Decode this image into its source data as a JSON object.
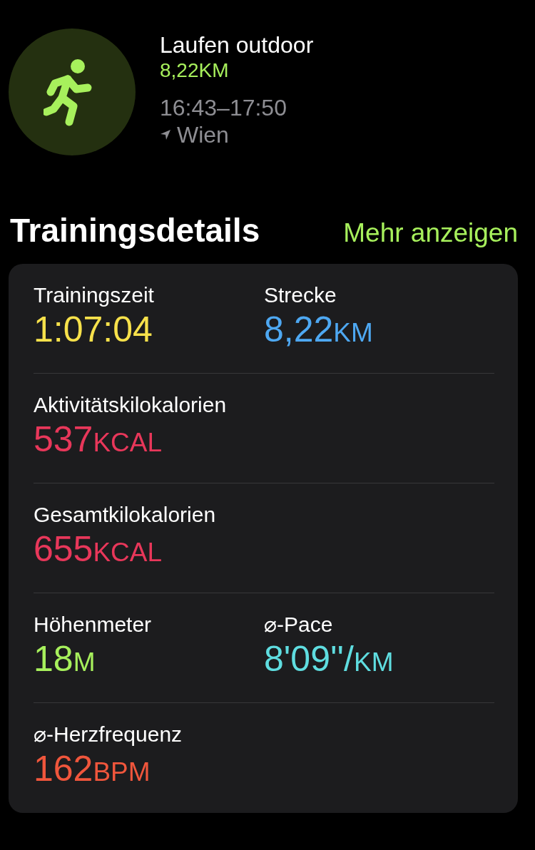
{
  "workout": {
    "title": "Laufen outdoor",
    "distance": "8,22KM",
    "time": "16:43–17:50",
    "location": "Wien"
  },
  "section": {
    "title": "Trainingsdetails",
    "link": "Mehr anzeigen"
  },
  "rows": [
    {
      "metrics": [
        {
          "label": "Trainingszeit",
          "value": "1:07:04",
          "color": "#f7e14b"
        },
        {
          "label": "Strecke",
          "value": "8,22",
          "unit": "KM",
          "color": "#4ea8f2"
        }
      ]
    },
    {
      "metrics": [
        {
          "label": "Aktivitätskilokalorien",
          "value": "537",
          "unit": "KCAL",
          "color": "#e8375a"
        }
      ]
    },
    {
      "metrics": [
        {
          "label": "Gesamtkilokalorien",
          "value": "655",
          "unit": "KCAL",
          "color": "#e8375a"
        }
      ]
    },
    {
      "metrics": [
        {
          "label": "Höhenmeter",
          "value": "18",
          "unit": "M",
          "color": "#a7f05c"
        },
        {
          "label": "⌀-Pace",
          "value": "8'09''/",
          "unit": "KM",
          "color": "#5fdde0"
        }
      ]
    },
    {
      "metrics": [
        {
          "label": "⌀-Herzfrequenz",
          "value": "162",
          "unit": "BPM",
          "color": "#f0563c"
        }
      ]
    }
  ]
}
